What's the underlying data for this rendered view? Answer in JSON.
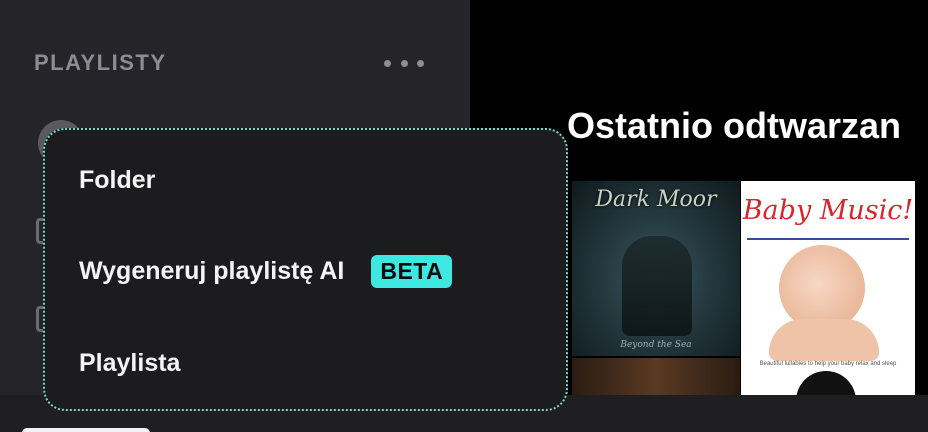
{
  "sidebar": {
    "title": "PLAYLISTY",
    "more_icon": "more-horizontal-icon"
  },
  "main": {
    "section_title": "Ostatnio odtwarzan",
    "covers": [
      {
        "title": "Dark Moor",
        "subtitle": "Beyond the Sea"
      },
      {
        "title": "Baby Music!",
        "tagline": "Beautiful lullabies to help your baby relax and sleep"
      }
    ]
  },
  "menu": {
    "items": [
      {
        "label": "Folder"
      },
      {
        "label": "Wygeneruj playlistę AI",
        "badge": "BETA"
      },
      {
        "label": "Playlista"
      }
    ]
  },
  "colors": {
    "badge": "#3ee8e0",
    "popup_border": "#6fd6c8",
    "sidebar_bg": "#252428",
    "popup_bg": "#1c1c1e"
  }
}
